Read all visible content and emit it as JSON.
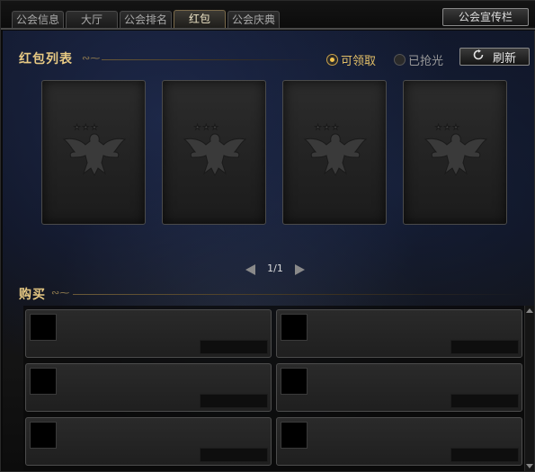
{
  "tabs": [
    {
      "label": "公会信息",
      "active": false
    },
    {
      "label": "大厅",
      "active": false
    },
    {
      "label": "公会排名",
      "active": false
    },
    {
      "label": "红包",
      "active": true
    },
    {
      "label": "公会庆典",
      "active": false
    }
  ],
  "promo_button": {
    "label": "公会宣传栏"
  },
  "red_packets": {
    "title": "红包列表",
    "filters": [
      {
        "label": "可领取",
        "selected": true
      },
      {
        "label": "已抢光",
        "selected": false
      }
    ],
    "refresh_label": "刷新",
    "refresh_icon": "refresh-icon",
    "cards": [
      {
        "emblem": "eagle-emblem-icon"
      },
      {
        "emblem": "eagle-emblem-icon"
      },
      {
        "emblem": "eagle-emblem-icon"
      },
      {
        "emblem": "eagle-emblem-icon"
      }
    ],
    "pager": {
      "text": "1/1"
    }
  },
  "buy": {
    "title": "购买",
    "items": [
      {},
      {},
      {},
      {},
      {},
      {}
    ]
  },
  "colors": {
    "accent_gold": "#e7c983",
    "panel_dark": "#1f1f1f"
  }
}
